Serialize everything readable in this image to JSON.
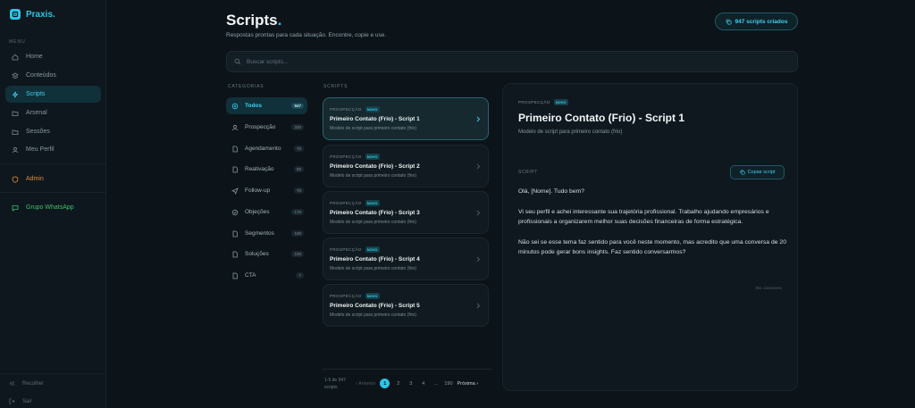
{
  "brand": {
    "name": "Praxis",
    "dot": "."
  },
  "sidebar": {
    "section_label": "MENU",
    "items": [
      {
        "label": "Home",
        "icon": "home-icon"
      },
      {
        "label": "Conteúdos",
        "icon": "layers-icon"
      },
      {
        "label": "Scripts",
        "icon": "bolt-icon",
        "active": true
      },
      {
        "label": "Arsenal",
        "icon": "folder-icon"
      },
      {
        "label": "Sessões",
        "icon": "folder-icon"
      },
      {
        "label": "Meu Perfil",
        "icon": "user-icon"
      }
    ],
    "admin_label": "Admin",
    "whatsapp_label": "Grupo WhatsApp",
    "collapse_label": "Recolher",
    "logout_label": "Sair"
  },
  "header": {
    "title": "Scripts",
    "title_dot": ".",
    "subtitle": "Respostas prontas para cada situação. Encontre, copie e use.",
    "count_label": "947 scripts criados"
  },
  "search": {
    "placeholder": "Buscar scripts..."
  },
  "categories": {
    "label": "CATEGORIAS",
    "items": [
      {
        "label": "Todos",
        "count": "947",
        "icon": "grid-icon",
        "active": true
      },
      {
        "label": "Prospecção",
        "count": "330",
        "icon": "user-icon"
      },
      {
        "label": "Agendamento",
        "count": "70",
        "icon": "file-icon"
      },
      {
        "label": "Reativação",
        "count": "60",
        "icon": "file-icon"
      },
      {
        "label": "Follow-up",
        "count": "70",
        "icon": "send-icon"
      },
      {
        "label": "Objeções",
        "count": "170",
        "icon": "shield-icon"
      },
      {
        "label": "Segmentos",
        "count": "100",
        "icon": "file-icon"
      },
      {
        "label": "Soluções",
        "count": "100",
        "icon": "file-icon"
      },
      {
        "label": "CTA",
        "count": "7",
        "icon": "file-icon"
      }
    ]
  },
  "scripts": {
    "label": "SCRIPTS",
    "items": [
      {
        "category": "PROSPECÇÃO",
        "badge": "NOVO",
        "title": "Primeiro Contato (Frio) - Script 1",
        "desc": "Modelo de script para primeiro contato (frio)",
        "active": true
      },
      {
        "category": "PROSPECÇÃO",
        "badge": "NOVO",
        "title": "Primeiro Contato (Frio) - Script 2",
        "desc": "Modelo de script para primeiro contato (frio)"
      },
      {
        "category": "PROSPECÇÃO",
        "badge": "NOVO",
        "title": "Primeiro Contato (Frio) - Script 3",
        "desc": "Modelo de script para primeiro contato (frio)"
      },
      {
        "category": "PROSPECÇÃO",
        "badge": "NOVO",
        "title": "Primeiro Contato (Frio) - Script 4",
        "desc": "Modelo de script para primeiro contato (frio)"
      },
      {
        "category": "PROSPECÇÃO",
        "badge": "NOVO",
        "title": "Primeiro Contato (Frio) - Script 5",
        "desc": "Modelo de script para primeiro contato (frio)"
      }
    ]
  },
  "pagination": {
    "range_label": "1-5 de 947 scripts",
    "prev_label": "Anterior",
    "pages": [
      "1",
      "2",
      "3",
      "4",
      "...",
      "190"
    ],
    "current_page": "1",
    "next_label": "Próxima"
  },
  "detail": {
    "category": "PROSPECÇÃO",
    "badge": "NOVO",
    "title": "Primeiro Contato (Frio) - Script 1",
    "desc": "Modelo de script para primeiro contato (frio)",
    "script_label": "SCRIPT",
    "copy_label": "Copiar script",
    "paragraphs": [
      "Olá, [Nome]. Tudo bem?",
      "Vi seu perfil e achei interessante sua trajetória profissional. Trabalho ajudando empresários e profissionais a organizarem melhor suas decisões financeiras de forma estratégica.",
      "Não sei se esse tema faz sentido para você neste momento, mas acredito que uma conversa de 20 minutos pode gerar bons insights. Faz sentido conversarmos?"
    ],
    "char_count": "351 caracteres"
  },
  "colors": {
    "accent": "#2ec4e6",
    "background": "#0c1419",
    "admin": "#e08c3c",
    "whatsapp": "#3fbf6a"
  }
}
